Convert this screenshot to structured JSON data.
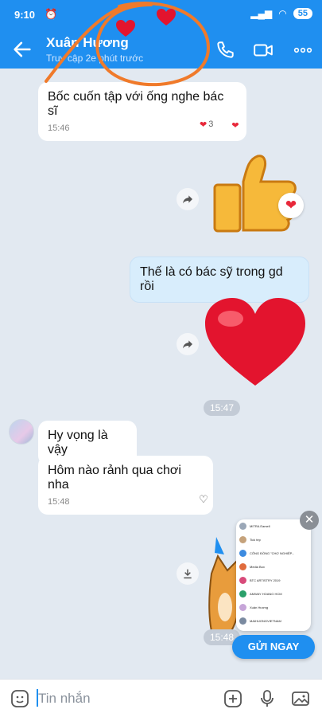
{
  "status_bar": {
    "time": "9:10",
    "battery": "55"
  },
  "header": {
    "name": "Xuân Hương",
    "status": "Truy cập 2e phút trước"
  },
  "messages": [
    {
      "text": "Bốc cuốn tập với ống nghe bác sĩ",
      "time": "15:46",
      "reaction_count": "3"
    },
    {
      "text": "Thế là có bác sỹ trong gd rồi"
    },
    {
      "time_pill": "15:47"
    },
    {
      "text": "Hy vọng là vậy"
    },
    {
      "text": "Hôm nào rảnh qua chơi nha",
      "time": "15:48"
    },
    {
      "time_pill": "15:48"
    }
  ],
  "mini_list": [
    {
      "name": "MITRA Eamell",
      "color": "#9aa7b7"
    },
    {
      "name": "Tick tép",
      "color": "#c5a27b"
    },
    {
      "name": "CÔNG ĐỒNG \"CHỢ NGHIỆP...",
      "color": "#3d8be0"
    },
    {
      "name": "Media Box",
      "color": "#e06b3d"
    },
    {
      "name": "BTC ARTISTRY 2019",
      "color": "#d84a7a"
    },
    {
      "name": "AMWAY HOANG HCM",
      "color": "#2aa06a"
    },
    {
      "name": "Xuân Hương",
      "color": "#c6a5d8"
    },
    {
      "name": "MAIHUONGVIETNAM",
      "color": "#7a8aa0"
    }
  ],
  "send_button": "GỬI NGAY",
  "input": {
    "placeholder": "Tin nhắn"
  },
  "colors": {
    "accent": "#1f8ff0",
    "scribble": "#f07a2a"
  }
}
